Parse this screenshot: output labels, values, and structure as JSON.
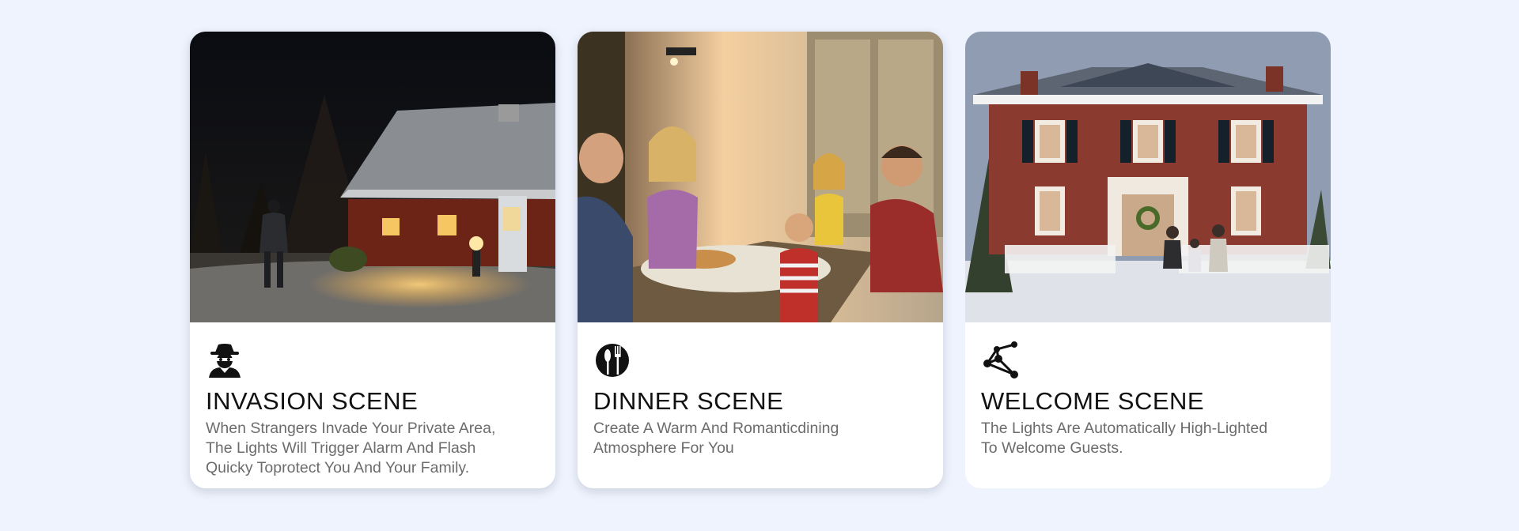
{
  "cards": [
    {
      "icon": "intruder-icon",
      "title": "INVASION SCENE",
      "desc_lines": [
        "When Strangers Invade Your Private Area,",
        "The Lights Will Trigger Alarm And Flash",
        "Quicky Toprotect You And Your Family."
      ]
    },
    {
      "icon": "cutlery-icon",
      "title": "DINNER SCENE",
      "desc_lines": [
        "Create A Warm And Romanticdining",
        "Atmosphere For You"
      ]
    },
    {
      "icon": "connection-nodes-icon",
      "title": "WELCOME SCENE",
      "desc_lines": [
        "The Lights Are Automatically High-Lighted",
        "To Welcome Guests."
      ]
    }
  ]
}
